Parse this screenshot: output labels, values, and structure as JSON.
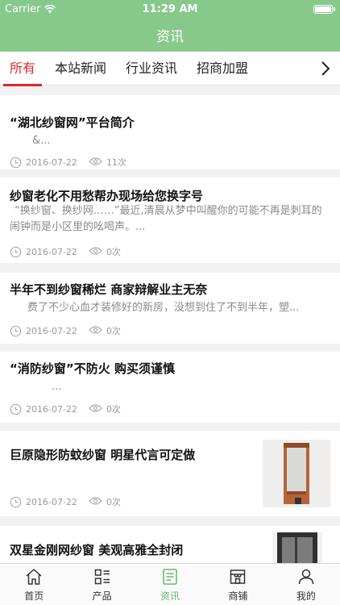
{
  "status_bar": {
    "carrier": "Carrier",
    "time": "11:29 AM"
  },
  "header": {
    "title": "资讯"
  },
  "tabs": [
    {
      "label": "所有"
    },
    {
      "label": "本站新闻"
    },
    {
      "label": "行业资讯"
    },
    {
      "label": "招商加盟"
    }
  ],
  "articles": [
    {
      "title": "“湖北纱窗网”平台简介",
      "summary": "&...",
      "date": "2016-07-22",
      "views": "11次"
    },
    {
      "title": "纱窗老化不用愁帮办现场给您换字号",
      "summary": "“换纱窗、换纱网……”最近,清晨从梦中叫醒你的可能不再是刺耳的闹钟而是小区里的吆喝声。...",
      "date": "2016-07-22",
      "views": "0次"
    },
    {
      "title": "半年不到纱窗稀烂 商家辩解业主无奈",
      "summary": "费了不少心血才装修好的新房，没想到住了不到半年，塑...",
      "date": "2016-07-22",
      "views": "0次"
    },
    {
      "title": "“消防纱窗”不防火 购买须谨慎",
      "summary": "...",
      "date": "2016-07-22",
      "views": "0次"
    },
    {
      "title": "巨原隐形防蚊纱窗 明星代言可定做",
      "summary": "",
      "date": "2016-07-22",
      "views": "0次"
    },
    {
      "title": "双星金刚网纱窗 美观高雅全封闭",
      "summary": "",
      "date": "",
      "views": ""
    }
  ],
  "bottom_tabs": [
    {
      "label": "首页",
      "icon": "home-icon"
    },
    {
      "label": "产品",
      "icon": "product-grid-icon"
    },
    {
      "label": "资讯",
      "icon": "news-icon",
      "active": true
    },
    {
      "label": "商铺",
      "icon": "shop-icon"
    },
    {
      "label": "我的",
      "icon": "user-icon"
    }
  ],
  "colors": {
    "header": "#86c98a",
    "accent_red": "#e0262a",
    "active_green": "#6bb86f"
  }
}
